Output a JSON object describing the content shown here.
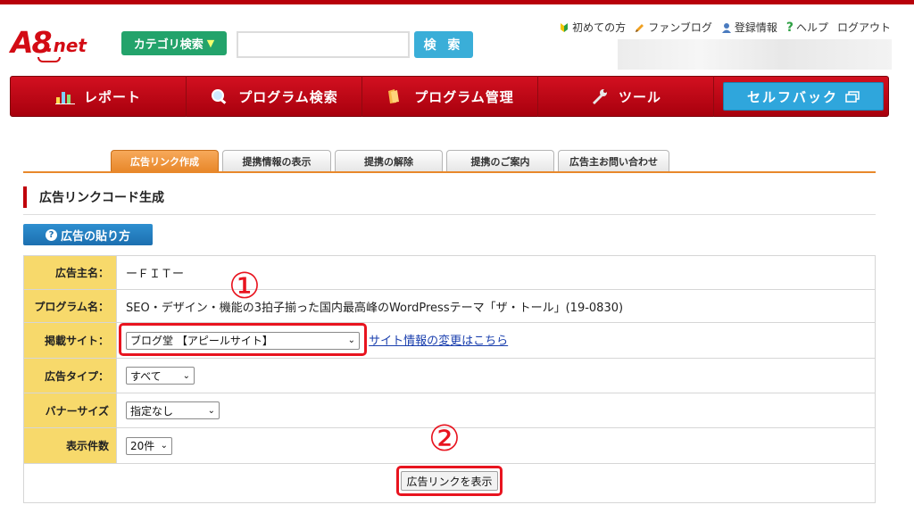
{
  "brand": {
    "logo_main": "A8",
    "logo_suffix": ".net"
  },
  "header": {
    "category_button": "カテゴリ検索",
    "search_placeholder": "",
    "search_button": "検 索",
    "links": [
      "初めての方",
      "ファンブログ",
      "登録情報",
      "ヘルプ",
      "ログアウト"
    ]
  },
  "nav": {
    "items": [
      "レポート",
      "プログラム検索",
      "プログラム管理",
      "ツール"
    ],
    "self_back": "セルフバック"
  },
  "tabs": [
    "広告リンク作成",
    "提携情報の表示",
    "提携の解除",
    "提携のご案内",
    "広告主お問い合わせ"
  ],
  "page_title": "広告リンクコード生成",
  "howto_button": "広告の貼り方",
  "form": {
    "advertiser_label": "広告主名：",
    "advertiser_value": "ーＦＩＴー",
    "program_label": "プログラム名：",
    "program_value": "SEO・デザイン・機能の3拍子揃った国内最高峰のWordPressテーマ「ザ・トール」(19-0830)",
    "site_label": "掲載サイト：",
    "site_value": "ブログ堂 【アピールサイト】",
    "site_link": "サイト情報の変更はこちら",
    "adtype_label": "広告タイプ：",
    "adtype_value": "すべて",
    "banner_label": "バナーサイズ",
    "banner_value": "指定なし",
    "count_label": "表示件数",
    "count_value": "20件"
  },
  "show_button": "広告リンクを表示",
  "annotations": {
    "mark1": "①",
    "mark2": "②"
  },
  "colors": {
    "brand_red": "#c0000b",
    "nav_red": "#d21020",
    "accent_orange": "#e8882b",
    "label_yellow": "#f7d96b",
    "highlight_red": "#e8141f"
  }
}
